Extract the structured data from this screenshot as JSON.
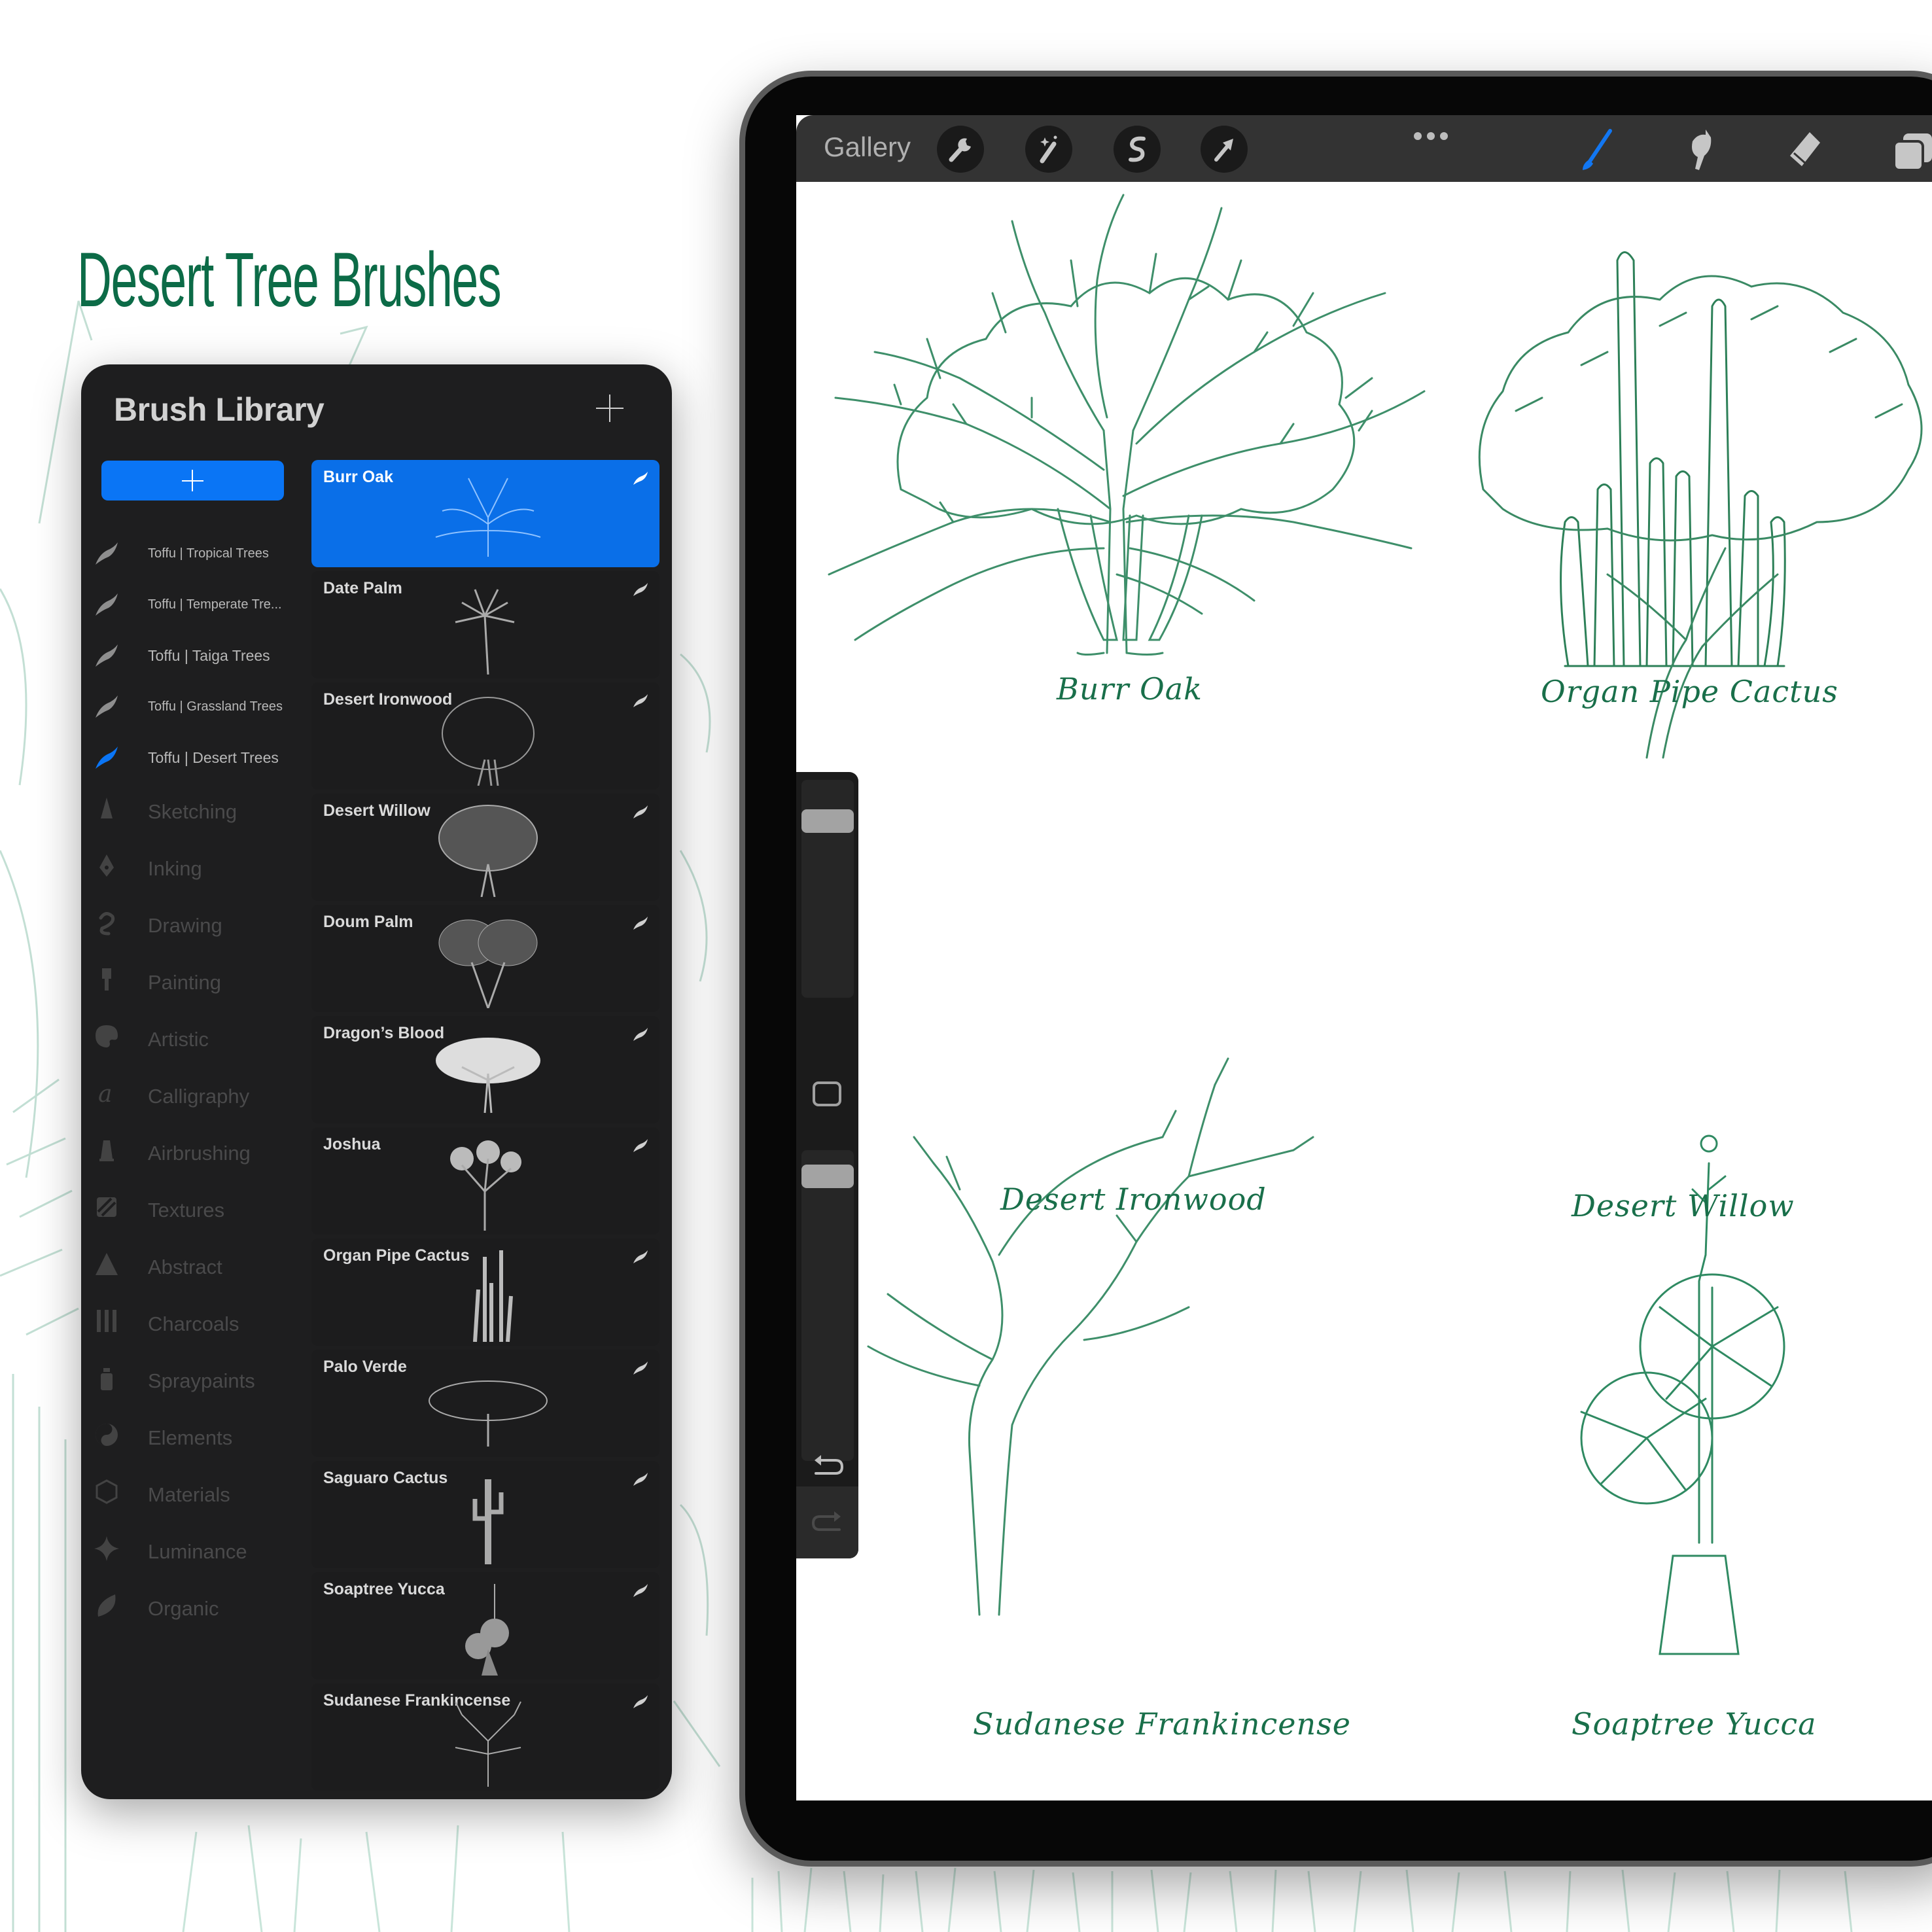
{
  "hero": {
    "title": "Desert Tree Brushes"
  },
  "colors": {
    "accent_blue": "#0a75f5",
    "title_green": "#0c6b47",
    "label_green": "#196f4a",
    "illustration_green": "#3e8f6a",
    "panel_bg": "#1e1e1f",
    "toolbar_bg": "#333333"
  },
  "brush_library": {
    "title": "Brush Library",
    "add_brush_icon": "plus-icon",
    "add_set_icon": "plus-icon",
    "sets": [
      {
        "label": "Toffu | Tropical Trees",
        "icon": "brush-stroke-icon",
        "selected": false
      },
      {
        "label": "Toffu | Temperate Tre...",
        "icon": "brush-stroke-icon",
        "selected": false
      },
      {
        "label": "Toffu | Taiga Trees",
        "icon": "brush-stroke-icon",
        "selected": false
      },
      {
        "label": "Toffu | Grassland Trees",
        "icon": "brush-stroke-icon",
        "selected": false
      },
      {
        "label": "Toffu | Desert Trees",
        "icon": "brush-stroke-icon",
        "selected": true
      }
    ],
    "categories": [
      {
        "label": "Sketching",
        "icon": "pencil-tip-icon"
      },
      {
        "label": "Inking",
        "icon": "pen-nib-icon"
      },
      {
        "label": "Drawing",
        "icon": "squiggle-icon"
      },
      {
        "label": "Painting",
        "icon": "paintbrush-icon"
      },
      {
        "label": "Artistic",
        "icon": "palette-icon"
      },
      {
        "label": "Calligraphy",
        "icon": "calligraphy-a-icon"
      },
      {
        "label": "Airbrushing",
        "icon": "airbrush-icon"
      },
      {
        "label": "Textures",
        "icon": "texture-stripes-icon"
      },
      {
        "label": "Abstract",
        "icon": "triangle-icon"
      },
      {
        "label": "Charcoals",
        "icon": "charcoal-sticks-icon"
      },
      {
        "label": "Spraypaints",
        "icon": "spray-can-icon"
      },
      {
        "label": "Elements",
        "icon": "yin-yang-icon"
      },
      {
        "label": "Materials",
        "icon": "cube-icon"
      },
      {
        "label": "Luminance",
        "icon": "sparkle-icon"
      },
      {
        "label": "Organic",
        "icon": "leaf-icon"
      }
    ],
    "brushes": [
      {
        "name": "Burr Oak",
        "selected": true
      },
      {
        "name": "Date Palm",
        "selected": false
      },
      {
        "name": "Desert Ironwood",
        "selected": false
      },
      {
        "name": "Desert Willow",
        "selected": false
      },
      {
        "name": "Doum Palm",
        "selected": false
      },
      {
        "name": "Dragon’s Blood",
        "selected": false
      },
      {
        "name": "Joshua",
        "selected": false
      },
      {
        "name": "Organ Pipe Cactus",
        "selected": false
      },
      {
        "name": "Palo Verde",
        "selected": false
      },
      {
        "name": "Saguaro Cactus",
        "selected": false
      },
      {
        "name": "Soaptree Yucca",
        "selected": false
      },
      {
        "name": "Sudanese Frankincense",
        "selected": false
      }
    ]
  },
  "toolbar": {
    "gallery_label": "Gallery",
    "left_tools": [
      "wrench-icon",
      "magic-wand-icon",
      "selection-s-icon",
      "transform-arrow-icon"
    ],
    "more_icon": "more-dots-icon",
    "right_tools": [
      {
        "icon": "paintbrush-icon",
        "active": true
      },
      {
        "icon": "smudge-icon",
        "active": false
      },
      {
        "icon": "eraser-icon",
        "active": false
      },
      {
        "icon": "layers-icon",
        "active": false
      }
    ]
  },
  "side_controls": {
    "brush_size_level": 0.85,
    "opacity_level": 0.95,
    "modify_icon": "square-outline-icon",
    "undo_icon": "undo-arrow-icon",
    "redo_icon": "redo-arrow-icon"
  },
  "canvas": {
    "labels": [
      "Burr Oak",
      "Organ Pipe Cactus",
      "Desert Ironwood",
      "Desert Willow",
      "Sudanese Frankincense",
      "Soaptree Yucca"
    ]
  }
}
